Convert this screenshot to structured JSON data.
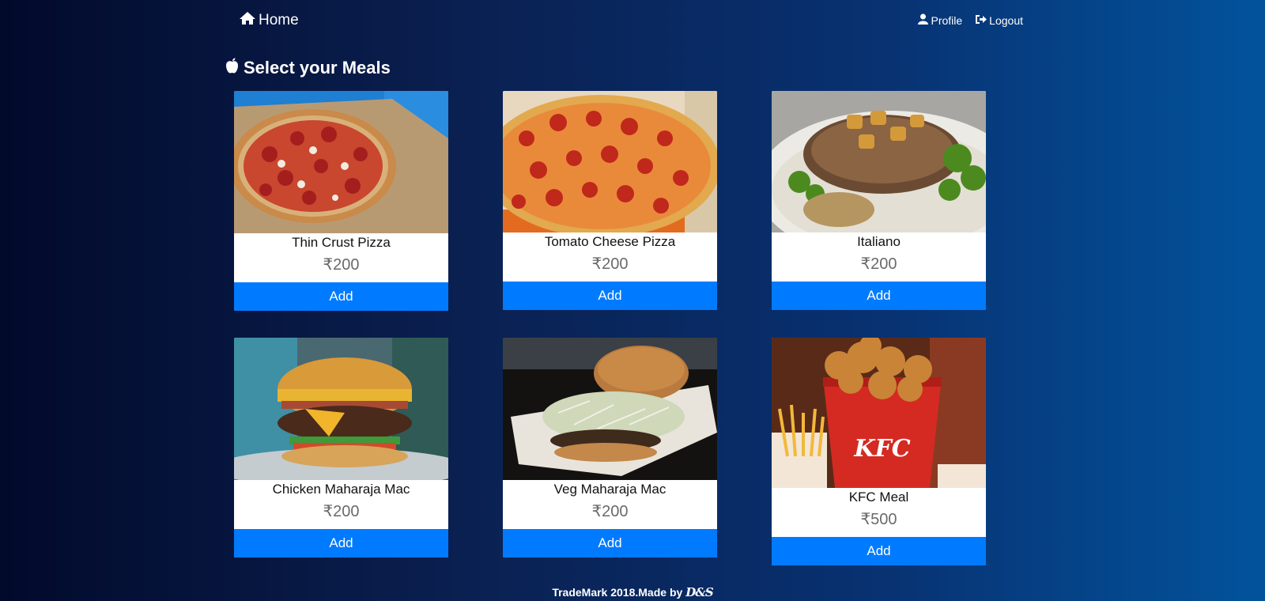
{
  "nav": {
    "home_label": "Home",
    "profile_label": "Profile",
    "logout_label": "Logout"
  },
  "section": {
    "title": "Select your Meals"
  },
  "currency_symbol": "₹",
  "meals": [
    {
      "name": "Thin Crust Pizza",
      "price": "₹200",
      "button": "Add",
      "image": "pizza-thin-crust"
    },
    {
      "name": "Tomato Cheese Pizza",
      "price": "₹200",
      "button": "Add",
      "image": "pizza-pepperoni"
    },
    {
      "name": "Italiano",
      "price": "₹200",
      "button": "Add",
      "image": "steak-plate"
    },
    {
      "name": "Chicken Maharaja Mac",
      "price": "₹200",
      "button": "Add",
      "image": "burger-cheese"
    },
    {
      "name": "Veg Maharaja Mac",
      "price": "₹200",
      "button": "Add",
      "image": "burger-veg"
    },
    {
      "name": "KFC Meal",
      "price": "₹500",
      "button": "Add",
      "image": "kfc-bucket"
    }
  ],
  "footer": {
    "text": "TradeMark 2018.Made by",
    "brand": "D&S"
  },
  "colors": {
    "accent": "#007bff",
    "price": "#6a6a6a"
  }
}
